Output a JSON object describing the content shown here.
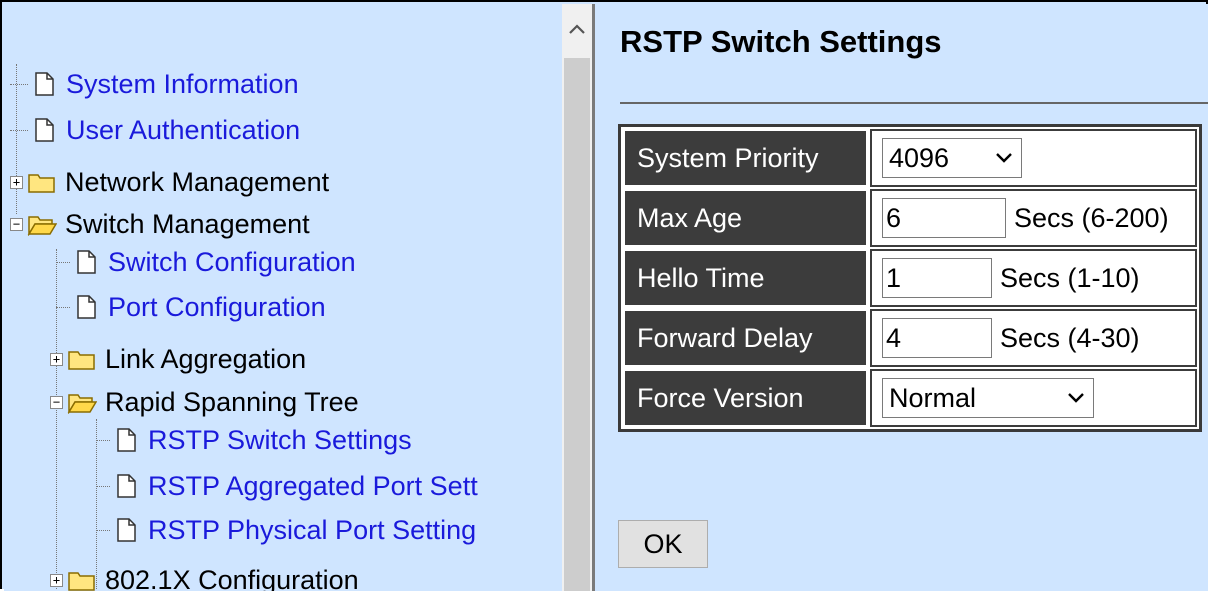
{
  "tree": {
    "items": [
      {
        "label": "System Information"
      },
      {
        "label": "User Authentication"
      },
      {
        "label": "Network Management"
      },
      {
        "label": "Switch Management"
      },
      {
        "label": "Switch Configuration"
      },
      {
        "label": "Port Configuration"
      },
      {
        "label": "Link Aggregation"
      },
      {
        "label": "Rapid Spanning Tree"
      },
      {
        "label": "RSTP Switch Settings"
      },
      {
        "label": "RSTP Aggregated Port Sett"
      },
      {
        "label": "RSTP Physical Port Setting"
      },
      {
        "label": "802.1X Configuration"
      }
    ],
    "expander_plus": "+",
    "expander_minus": "−"
  },
  "scrollbar": {
    "up_icon": "chevron-up-icon"
  },
  "main": {
    "title": "RSTP Switch Settings",
    "rows": [
      {
        "label": "System Priority",
        "value": "4096"
      },
      {
        "label": "Max Age",
        "value": "6",
        "suffix": "Secs (6-200)"
      },
      {
        "label": "Hello Time",
        "value": "1",
        "suffix": "Secs (1-10)"
      },
      {
        "label": "Forward Delay",
        "value": "4",
        "suffix": "Secs (4-30)"
      },
      {
        "label": "Force Version",
        "value": "Normal"
      }
    ],
    "ok_label": "OK"
  },
  "colors": {
    "background": "#cfe5ff",
    "link": "#1a1adb",
    "header_cell": "#3c3c3c"
  }
}
